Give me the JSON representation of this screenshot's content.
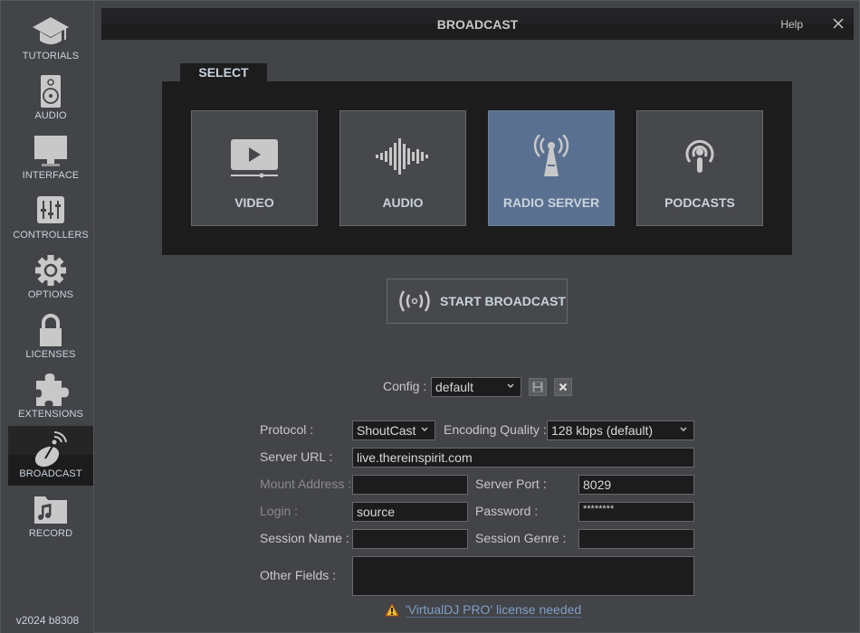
{
  "sidebar": {
    "items": [
      {
        "label": "TUTORIALS",
        "icon": "graduation-cap-icon"
      },
      {
        "label": "AUDIO",
        "icon": "speaker-icon"
      },
      {
        "label": "INTERFACE",
        "icon": "monitor-icon"
      },
      {
        "label": "CONTROLLERS",
        "icon": "sliders-icon"
      },
      {
        "label": "OPTIONS",
        "icon": "gear-icon"
      },
      {
        "label": "LICENSES",
        "icon": "lock-icon"
      },
      {
        "label": "EXTENSIONS",
        "icon": "puzzle-icon"
      },
      {
        "label": "BROADCAST",
        "icon": "satellite-dish-icon",
        "active": true
      },
      {
        "label": "RECORD",
        "icon": "music-folder-icon"
      }
    ],
    "version": "v2024 b8308"
  },
  "header": {
    "title": "BROADCAST",
    "help_label": "Help"
  },
  "select": {
    "tab_label": "SELECT",
    "modes": [
      {
        "label": "VIDEO",
        "icon": "video-play-icon"
      },
      {
        "label": "AUDIO",
        "icon": "waveform-icon"
      },
      {
        "label": "RADIO SERVER",
        "icon": "radio-tower-icon",
        "selected": true
      },
      {
        "label": "PODCASTS",
        "icon": "podcast-icon"
      }
    ]
  },
  "start_broadcast": {
    "label": "START BROADCAST"
  },
  "config": {
    "label": "Config :",
    "value": "default"
  },
  "form": {
    "protocol_label": "Protocol :",
    "protocol_value": "ShoutCast",
    "encoding_label": "Encoding Quality :",
    "encoding_value": "128 kbps (default)",
    "server_url_label": "Server URL :",
    "server_url_value": "live.thereinspirit.com",
    "mount_label": "Mount Address :",
    "mount_value": "",
    "port_label": "Server Port :",
    "port_value": "8029",
    "login_label": "Login :",
    "login_value": "source",
    "password_label": "Password :",
    "password_value": "********",
    "session_name_label": "Session Name :",
    "session_name_value": "",
    "session_genre_label": "Session Genre :",
    "session_genre_value": "",
    "other_fields_label": "Other Fields :",
    "other_fields_value": ""
  },
  "license_notice": {
    "text": "'VirtualDJ PRO' license needed"
  },
  "colors": {
    "background": "#434448",
    "panel": "#1c1c1d",
    "selected_card": "#5a7090",
    "link": "#7f9fc7"
  }
}
